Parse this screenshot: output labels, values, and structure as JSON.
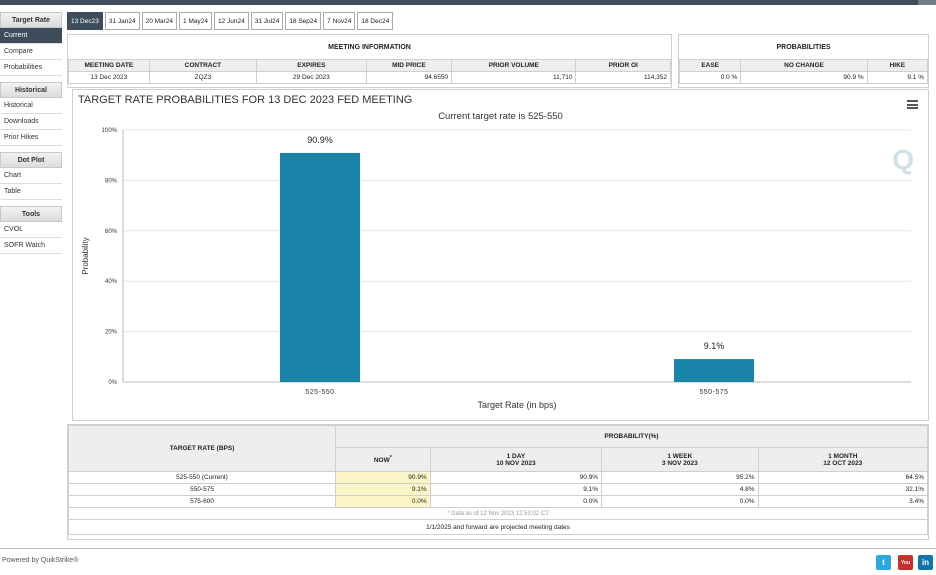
{
  "sidebar": {
    "sections": [
      {
        "title": "Target Rate",
        "items": [
          "Current",
          "Compare",
          "Probabilities"
        ]
      },
      {
        "title": "Historical",
        "items": [
          "Historical",
          "Downloads",
          "Prior Hikes"
        ]
      },
      {
        "title": "Dot Plot",
        "items": [
          "Chart",
          "Table"
        ]
      },
      {
        "title": "Tools",
        "items": [
          "CVOL",
          "SOFR Watch"
        ]
      }
    ]
  },
  "tabs": [
    "13 Dec23",
    "31 Jan24",
    "20 Mar24",
    "1 May24",
    "12 Jun24",
    "31 Jul24",
    "18 Sep24",
    "7 Nov24",
    "18 Dec24"
  ],
  "meeting_info": {
    "title": "MEETING INFORMATION",
    "headers": [
      "MEETING DATE",
      "CONTRACT",
      "EXPIRES",
      "MID PRICE",
      "PRIOR VOLUME",
      "PRIOR OI"
    ],
    "values": [
      "13 Dec 2023",
      "ZQZ3",
      "29 Dec 2023",
      "94.6550",
      "11,710",
      "114,352"
    ]
  },
  "probabilities": {
    "title": "PROBABILITIES",
    "headers": [
      "EASE",
      "NO CHANGE",
      "HIKE"
    ],
    "values": [
      "0.0 %",
      "90.9 %",
      "9.1 %"
    ]
  },
  "chart": {
    "title": "TARGET RATE PROBABILITIES FOR 13 DEC 2023 FED MEETING",
    "subtitle": "Current target rate is 525-550",
    "ylabel": "Probability",
    "xlabel": "Target Rate (in bps)",
    "yticks": [
      "0%",
      "20%",
      "40%",
      "60%",
      "80%",
      "100%"
    ],
    "bar_color": "#1a83a8"
  },
  "chart_data": {
    "type": "bar",
    "categories": [
      "525-550",
      "550-575"
    ],
    "values": [
      90.9,
      9.1
    ],
    "value_labels": [
      "90.9%",
      "9.1%"
    ],
    "title": "TARGET RATE PROBABILITIES FOR 13 DEC 2023 FED MEETING",
    "xlabel": "Target Rate (in bps)",
    "ylabel": "Probability",
    "ylim": [
      0,
      100
    ]
  },
  "prob_table": {
    "rate_header": "TARGET RATE (BPS)",
    "prob_header": "PROBABILITY(%)",
    "cols": [
      {
        "label": "NOW",
        "sub": "",
        "mark": "*"
      },
      {
        "label": "1 DAY",
        "sub": "10 NOV 2023",
        "mark": ""
      },
      {
        "label": "1 WEEK",
        "sub": "3 NOV 2023",
        "mark": ""
      },
      {
        "label": "1 MONTH",
        "sub": "12 OCT 2023",
        "mark": ""
      }
    ],
    "rows": [
      {
        "rate": "525-550 (Current)",
        "vals": [
          "90.9%",
          "90.9%",
          "95.2%",
          "64.5%"
        ]
      },
      {
        "rate": "550-575",
        "vals": [
          "9.1%",
          "9.1%",
          "4.8%",
          "32.1%"
        ]
      },
      {
        "rate": "575-600",
        "vals": [
          "0.0%",
          "0.0%",
          "0.0%",
          "3.4%"
        ]
      }
    ],
    "data_note": "* Data as of 12 Nov 2023 12:53:02 CT",
    "projection_note": "1/1/2025 and forward are projected meeting dates"
  },
  "footer": {
    "powered": "Powered by QuikStrike®",
    "social": [
      {
        "name": "twitter-icon",
        "glyph": "t",
        "color": "#2aa9e0"
      },
      {
        "name": "youtube-icon",
        "glyph": "You",
        "color": "#c4302b"
      },
      {
        "name": "linkedin-icon",
        "glyph": "in",
        "color": "#0e76a8"
      }
    ]
  },
  "watermark": "Q"
}
